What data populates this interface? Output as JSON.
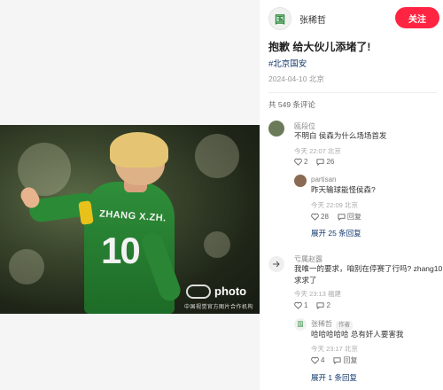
{
  "photo": {
    "jersey_name": "ZHANG X.ZH.",
    "jersey_number": "10",
    "watermark": "photo",
    "watermark_sub": "中国视觉官方图片合作机构"
  },
  "author": {
    "avatar_text": "国",
    "name": "张稀哲"
  },
  "follow_label": "关注",
  "post": {
    "title": "抱歉 给大伙儿添堵了!",
    "tag": "#北京国安",
    "meta": "2024-04-10 北京",
    "comment_count": "共 549 条评论"
  },
  "comments": [
    {
      "name": "瓯段位",
      "text": "不明白 侯森为什么场场首发",
      "meta": "今天 22:07 北京",
      "likes": "2",
      "replies": "26",
      "reply": {
        "name": "partisan",
        "text": "昨天输球能怪侯森?",
        "meta": "今天 22:09 北京",
        "likes": "28",
        "reply_label": "回复"
      },
      "expand": "展开 25 条回复"
    },
    {
      "name": "亏属赵露",
      "text_line1": "我唯一的要求，咱别在停赛了行吗? zhang10",
      "text_line2": "求求了",
      "meta": "今天 23:13 福建",
      "likes": "1",
      "replies": "2",
      "reply": {
        "name": "张稀哲",
        "badge": "作者",
        "text": "哈哈哈哈哈 总有奸人要害我",
        "meta": "今天 23:17 北京",
        "likes": "4",
        "reply_label": "回复"
      },
      "expand": "展开 1 条回复"
    }
  ],
  "colors": {
    "accent": "#ff2442",
    "link": "#13386c",
    "jersey": "#2b8a36"
  }
}
